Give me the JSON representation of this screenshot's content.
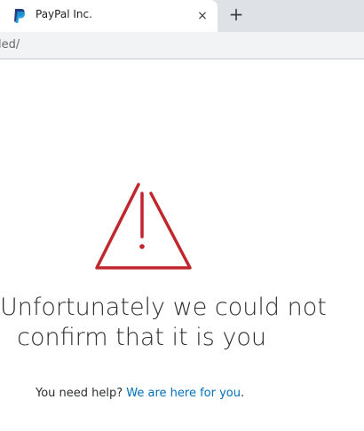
{
  "browser": {
    "tab": {
      "title": "PayPal Inc.",
      "close_glyph": "×",
      "favicon": "paypal-logo-icon"
    },
    "new_tab_glyph": "+",
    "address_bar": {
      "visible_url": "led/"
    }
  },
  "page": {
    "icon": "warning-triangle-icon",
    "icon_color": "#c0272d",
    "headline_line1": "Unfortunately we could not",
    "headline_line2": "confirm that it is you",
    "help_prefix": "You need help?",
    "help_link_text": "We are here for you",
    "help_suffix": ".",
    "link_color": "#0070ba"
  }
}
